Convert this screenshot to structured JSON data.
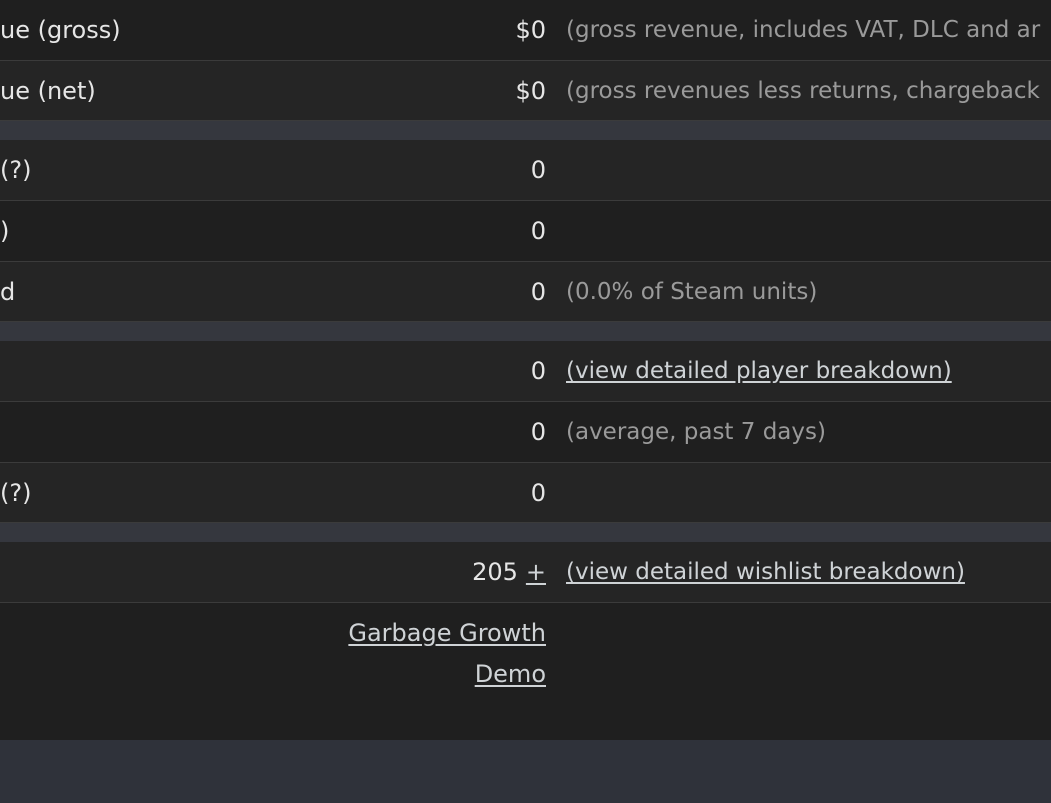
{
  "rows": {
    "revenue_gross": {
      "label": "ue (gross)",
      "value": "$0",
      "note": "(gross revenue, includes VAT, DLC and ar"
    },
    "revenue_net": {
      "label": "ue (net)",
      "value": "$0",
      "note": "(gross revenues less returns, chargeback"
    },
    "units_1": {
      "label": "(?)",
      "value": "0"
    },
    "units_2": {
      "label": ")",
      "value": "0"
    },
    "units_3": {
      "label": "d",
      "value": "0",
      "note": "(0.0% of Steam units)"
    },
    "players_1": {
      "label": "",
      "value": "0",
      "link": "(view detailed player breakdown)"
    },
    "players_2": {
      "label": "",
      "value": "0",
      "note": "(average, past 7 days)"
    },
    "players_3": {
      "label": " (?)",
      "value": "0"
    },
    "wishlists": {
      "label": "",
      "value": "205",
      "plus": "+",
      "link": "(view detailed wishlist breakdown)"
    },
    "demo": {
      "line1": "Garbage Growth",
      "line2": "Demo"
    }
  }
}
